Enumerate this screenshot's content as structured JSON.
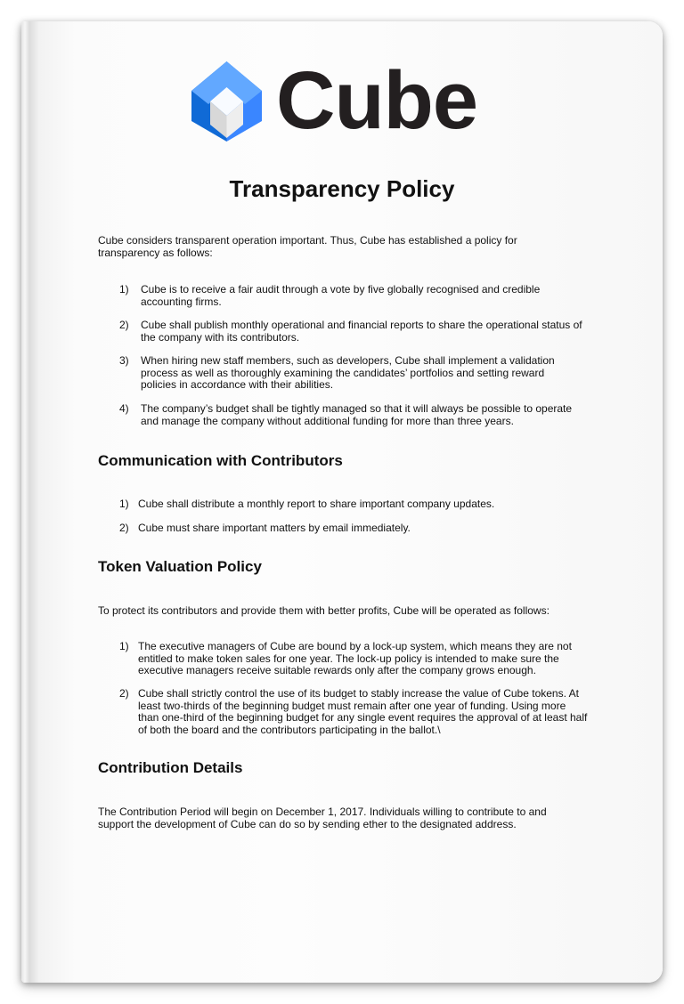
{
  "logo": {
    "text": "Cube",
    "colors": {
      "light": "#62a8ff",
      "mid": "#3a86ff",
      "dark": "#106ad6",
      "text": "#231f20"
    }
  },
  "title": "Transparency Policy",
  "intro": "Cube considers transparent operation important. Thus, Cube has established a policy for transparency as follows:",
  "transparency_items": [
    {
      "num": "1)",
      "text": "Cube is to receive a fair audit through a vote by five globally recognised and credible accounting firms."
    },
    {
      "num": "2)",
      "text": "Cube shall publish monthly operational and financial reports to share the operational status of the company with its contributors."
    },
    {
      "num": "3)",
      "text": "When hiring new staff members, such as developers, Cube shall implement a validation process as well as thoroughly examining the candidates’ portfolios and setting reward policies in accordance with their abilities."
    },
    {
      "num": "4)",
      "text": "The company’s budget shall be tightly managed so that it will always be possible to operate and manage the company without additional funding for more than three years."
    }
  ],
  "communication": {
    "heading": "Communication with Contributors",
    "items": [
      {
        "num": "1)",
        "text": "Cube shall distribute a monthly report to share important company updates."
      },
      {
        "num": "2)",
        "text": "Cube must share important matters by email immediately."
      }
    ]
  },
  "token": {
    "heading": "Token Valuation Policy",
    "intro": "To protect its contributors and provide them with better profits, Cube will be operated as follows:",
    "items": [
      {
        "num": "1)",
        "text": "The executive managers of Cube are bound by a lock-up system, which means they are not entitled to make token sales for one year. The lock-up policy is intended to make sure the executive managers receive suitable rewards only after the company grows enough."
      },
      {
        "num": "2)",
        "text": "Cube shall strictly control the use of its budget to stably increase the value of Cube tokens. At least two-thirds of the beginning budget must remain after one year of funding. Using more than one-third of the beginning budget for any single event requires the approval of at least half of both the board and the contributors participating in the ballot.\\"
      }
    ]
  },
  "contribution": {
    "heading": "Contribution Details",
    "text": "The Contribution Period will begin on December 1, 2017. Individuals willing to contribute to and support the development of Cube can do so by sending ether to the designated address."
  }
}
